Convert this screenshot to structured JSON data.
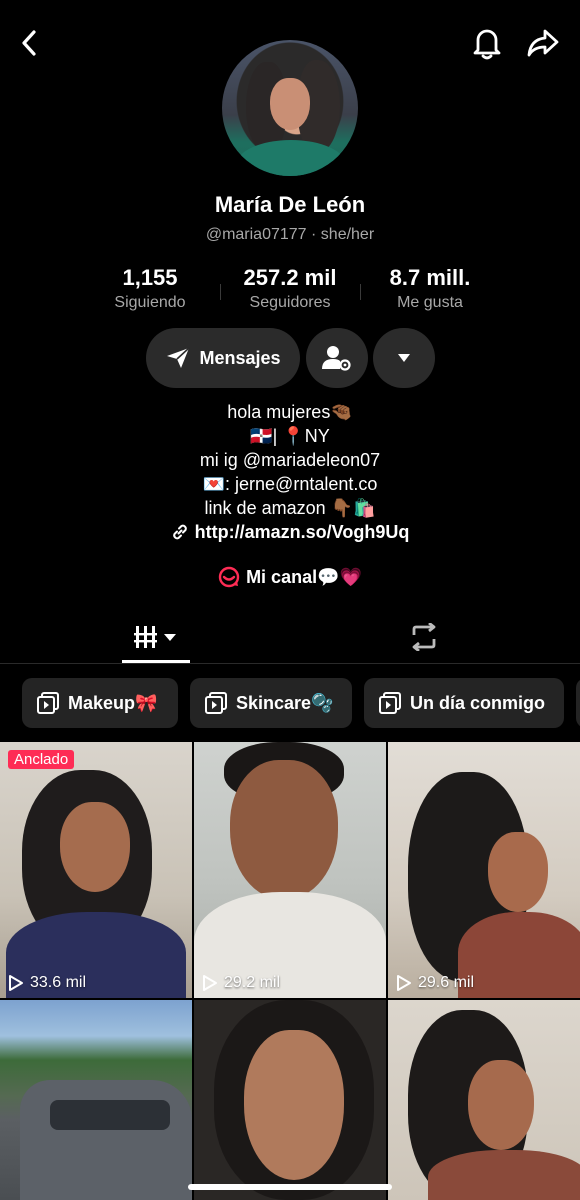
{
  "profile": {
    "name": "María De León",
    "handle": "@maria07177 · she/her"
  },
  "stats": [
    {
      "value": "1,155",
      "label": "Siguiendo"
    },
    {
      "value": "257.2 mil",
      "label": "Seguidores"
    },
    {
      "value": "8.7 mill.",
      "label": "Me gusta"
    }
  ],
  "actions": {
    "message_label": "Mensajes"
  },
  "bio": {
    "line1": "hola mujeres🤏🏾",
    "line2": "🇩🇴| 📍NY",
    "line3": "mi ig @mariadeleon07",
    "line4": "💌: jerne@rntalent.co",
    "line5": "link de amazon 👇🏾🛍️",
    "link": "http://amazn.so/Vogh9Uq",
    "channel": "Mi canal💬💗"
  },
  "playlists": [
    {
      "label": "Makeup🎀"
    },
    {
      "label": "Skincare🫧"
    },
    {
      "label": "Un día conmigo"
    }
  ],
  "videos": [
    {
      "views": "33.6 mil",
      "pinned": "Anclado"
    },
    {
      "views": "29.2 mil"
    },
    {
      "views": "29.6 mil"
    },
    {
      "views": ""
    },
    {
      "views": ""
    },
    {
      "views": ""
    }
  ],
  "colors": {
    "background": "#000000",
    "button_bg": "#2b2b2b",
    "pinned_badge": "#fe2c55",
    "muted_text": "#a8a8a8"
  },
  "icons": [
    "chevron-left-icon",
    "bell-icon",
    "share-icon",
    "send-icon",
    "add-friend-settings-icon",
    "chevron-down-icon",
    "link-icon",
    "channel-icon",
    "grid-icon",
    "repost-icon",
    "playlist-icon",
    "play-icon"
  ]
}
